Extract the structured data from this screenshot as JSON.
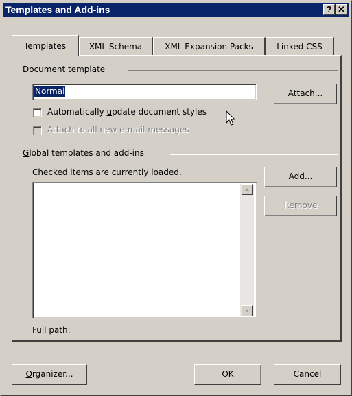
{
  "window": {
    "title": "Templates and Add-ins",
    "help_glyph": "?",
    "close_glyph": "✕"
  },
  "tabs": [
    {
      "label": "Templates",
      "active": true
    },
    {
      "label": "XML Schema",
      "active": false
    },
    {
      "label": "XML Expansion Packs",
      "active": false
    },
    {
      "label": "Linked CSS",
      "active": false
    }
  ],
  "document_template": {
    "group_label_pre": "Document ",
    "group_label_key": "t",
    "group_label_post": "emplate",
    "template_value": "Normal",
    "attach_pre": "",
    "attach_key": "A",
    "attach_post": "ttach...",
    "auto_update_pre": "Automatically ",
    "auto_update_key": "u",
    "auto_update_post": "pdate document styles",
    "auto_update_checked": false,
    "attach_email_label": "Attach to all new e-mail messages",
    "attach_email_enabled": false
  },
  "global": {
    "group_label_key": "G",
    "group_label_post": "lobal templates and add-ins",
    "loaded_note": "Checked items are currently loaded.",
    "add_pre": "A",
    "add_key": "d",
    "add_post": "d...",
    "remove_label": "Remove",
    "full_path_label": "Full path:"
  },
  "footer": {
    "organizer_key": "O",
    "organizer_post": "rganizer...",
    "ok_label": "OK",
    "cancel_label": "Cancel"
  },
  "colors": {
    "titlebar": "#0a246a",
    "face": "#d4d0c8",
    "selection": "#0a246a"
  },
  "icons": {
    "cursor": "mouse-pointer-icon",
    "scroll_up": "scroll-up-arrow-icon",
    "scroll_down": "scroll-down-arrow-icon"
  }
}
